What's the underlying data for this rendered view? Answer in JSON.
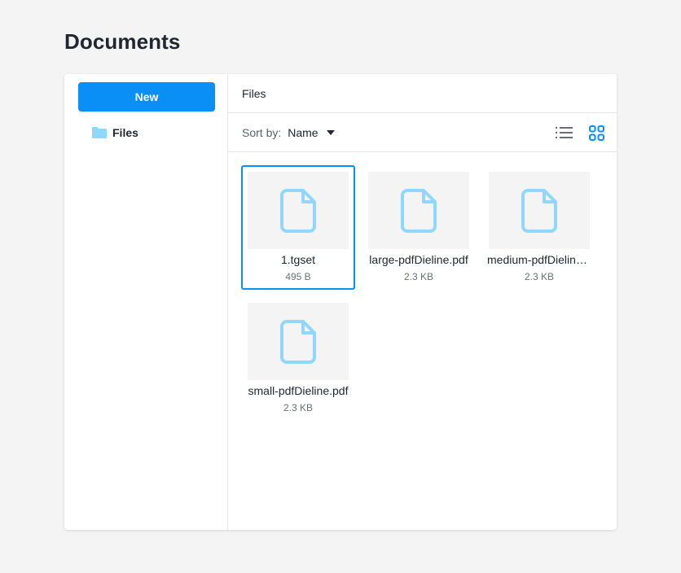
{
  "page": {
    "title": "Documents"
  },
  "sidebar": {
    "new_button_label": "New",
    "items": [
      {
        "label": "Files",
        "icon": "folder-icon"
      }
    ]
  },
  "main": {
    "breadcrumb": [
      "Files"
    ],
    "toolbar": {
      "sort_label": "Sort by:",
      "sort_value": "Name",
      "sort_icon": "caret-down-icon",
      "view_modes": [
        {
          "name": "list",
          "icon": "list-view-icon",
          "active": false
        },
        {
          "name": "grid",
          "icon": "grid-view-icon",
          "active": true
        }
      ]
    },
    "files": [
      {
        "name": "1.tgset",
        "size": "495 B",
        "selected": true,
        "icon": "file-icon"
      },
      {
        "name": "large-pdfDieline.pdf",
        "size": "2.3 KB",
        "selected": false,
        "icon": "file-icon"
      },
      {
        "name": "medium-pdfDieline.pdf",
        "size": "2.3 KB",
        "selected": false,
        "icon": "file-icon"
      },
      {
        "name": "small-pdfDieline.pdf",
        "size": "2.3 KB",
        "selected": false,
        "icon": "file-icon"
      }
    ]
  },
  "colors": {
    "accent": "#0a8ff7",
    "icon_light_blue": "#8fd7fe",
    "background": "#f4f4f4",
    "panel": "#ffffff",
    "inactive_icon": "#6b7078"
  }
}
